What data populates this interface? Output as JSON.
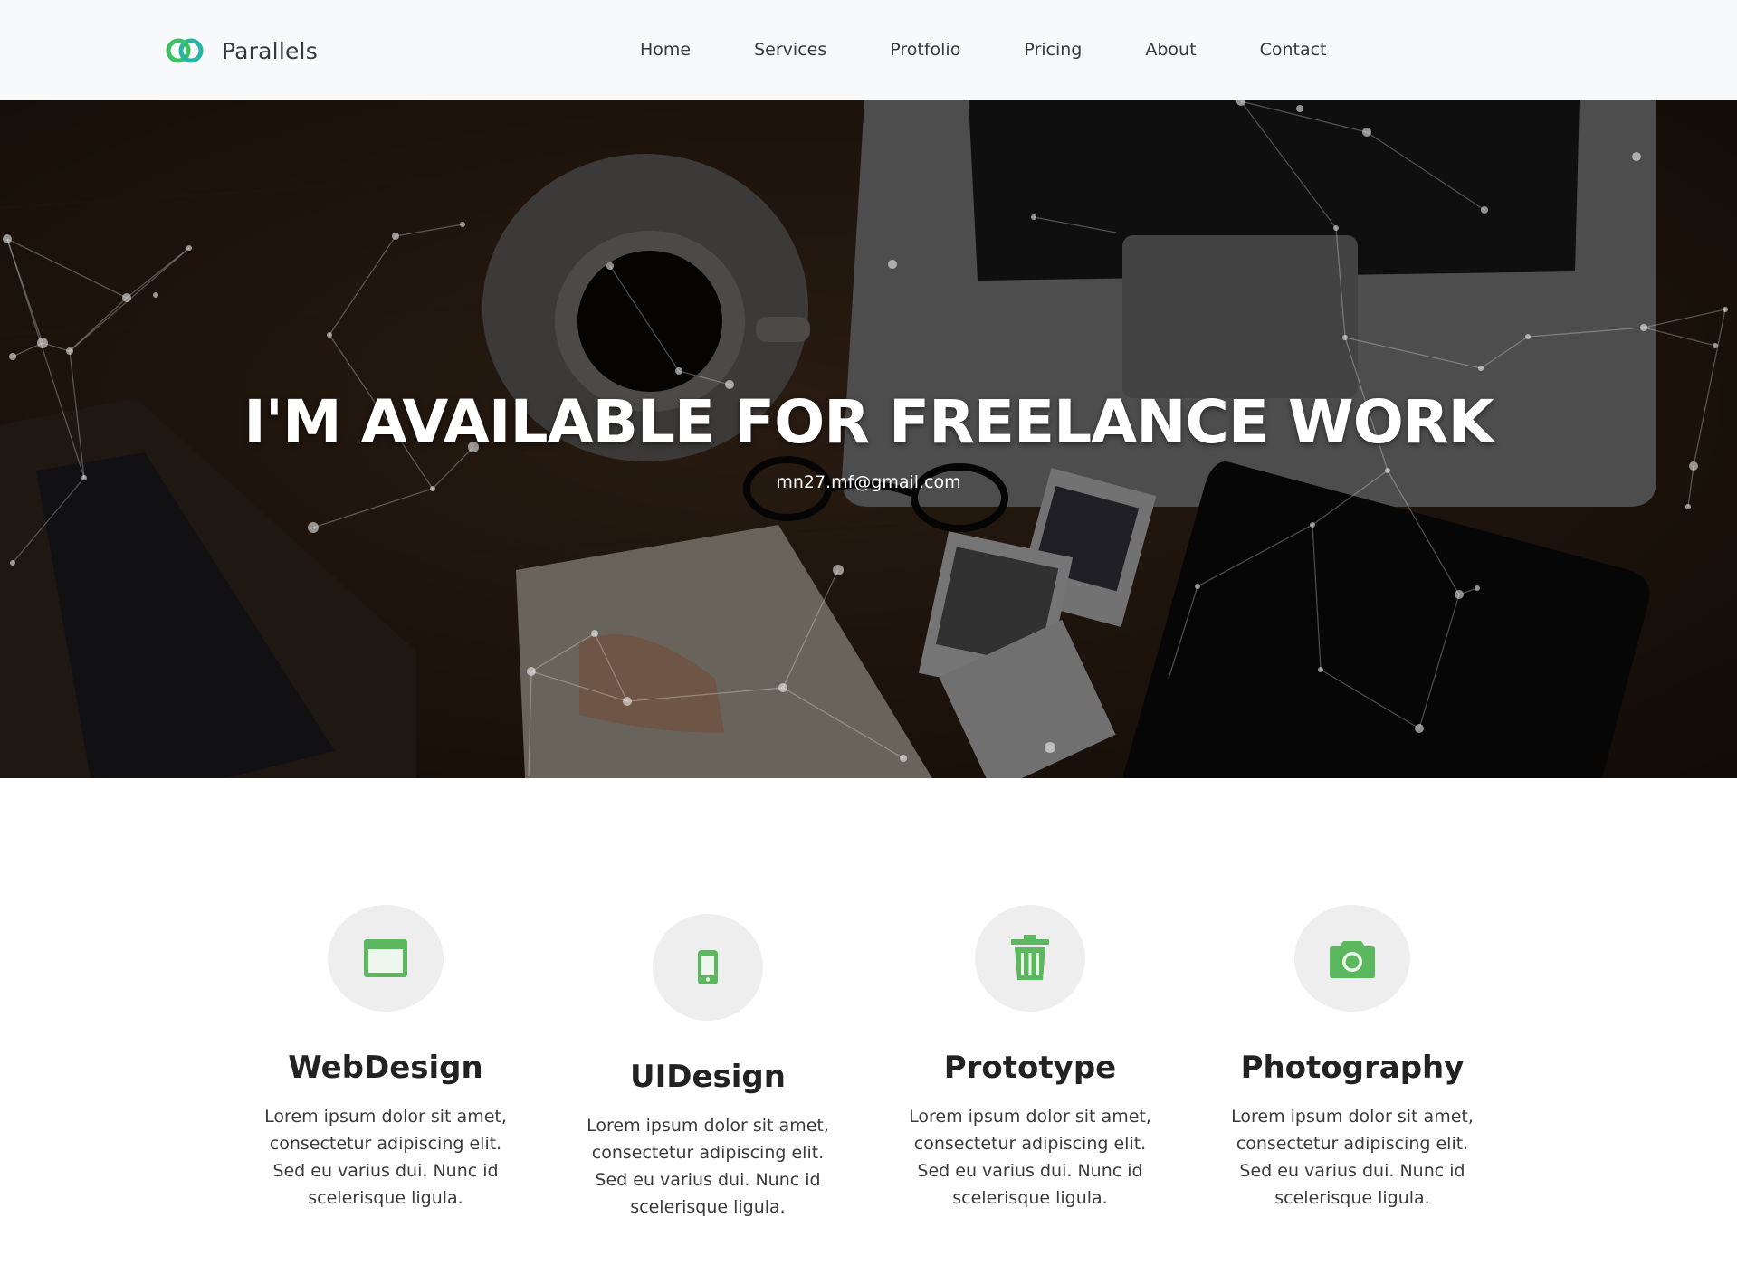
{
  "brand": {
    "name": "Parallels",
    "logo_icon": "link-rings-icon",
    "accent": "#3cc062"
  },
  "nav": {
    "items": [
      {
        "label": "Home"
      },
      {
        "label": "Services"
      },
      {
        "label": "Protfolio"
      },
      {
        "label": "Pricing"
      },
      {
        "label": "About"
      },
      {
        "label": "Contact"
      }
    ]
  },
  "hero": {
    "title": "I'M AVAILABLE FOR FREELANCE WORK",
    "email": "mn27.mf@gmail.com",
    "background": "desk-with-coffee-laptop-photos-image"
  },
  "services": [
    {
      "icon": "browser-window-icon",
      "title": "WebDesign",
      "description": "Lorem ipsum dolor sit amet, consectetur adipiscing elit. Sed eu varius dui. Nunc id scelerisque ligula."
    },
    {
      "icon": "mobile-phone-icon",
      "title": "UIDesign",
      "description": "Lorem ipsum dolor sit amet, consectetur adipiscing elit. Sed eu varius dui. Nunc id scelerisque ligula."
    },
    {
      "icon": "trash-can-icon",
      "title": "Prototype",
      "description": "Lorem ipsum dolor sit amet, consectetur adipiscing elit. Sed eu varius dui. Nunc id scelerisque ligula."
    },
    {
      "icon": "camera-icon",
      "title": "Photography",
      "description": "Lorem ipsum dolor sit amet, consectetur adipiscing elit. Sed eu varius dui. Nunc id scelerisque ligula."
    }
  ],
  "colors": {
    "icon_green": "#5cb85c",
    "navbar_bg": "#f8f9fa",
    "icon_circle_bg": "#eeeeee"
  }
}
